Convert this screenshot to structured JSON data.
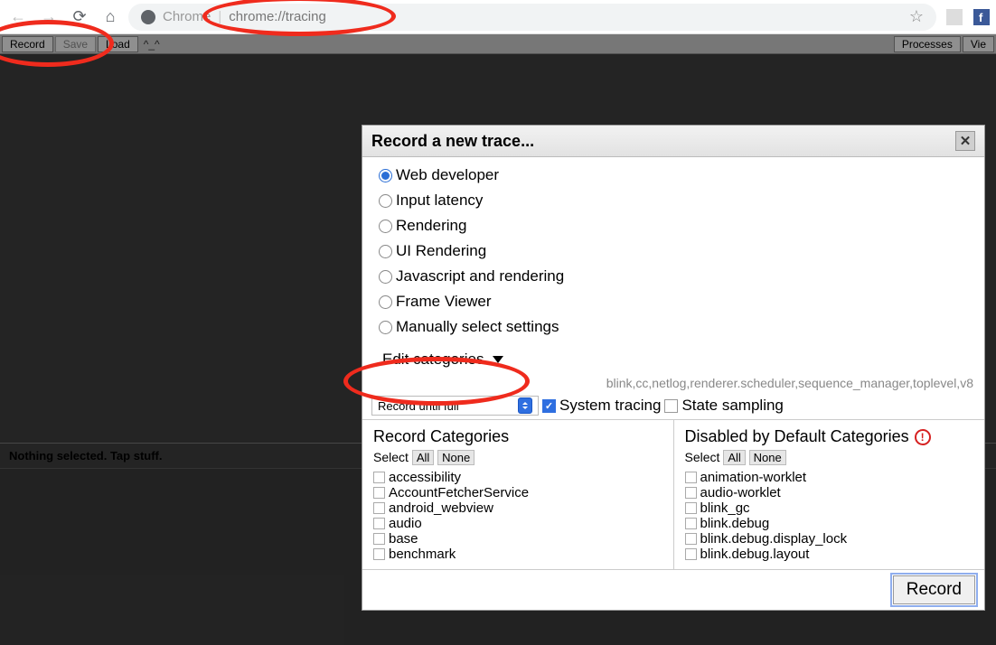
{
  "browser": {
    "prefix": "Chrome",
    "url": "chrome://tracing"
  },
  "toolbar": {
    "record": "Record",
    "save": "Save",
    "load": "Load",
    "emote": "^_^",
    "processes": "Processes",
    "view": "Vie"
  },
  "status": "Nothing selected. Tap stuff.",
  "dialog": {
    "title": "Record a new trace...",
    "radios": [
      "Web developer",
      "Input latency",
      "Rendering",
      "UI Rendering",
      "Javascript and rendering",
      "Frame Viewer",
      "Manually select settings"
    ],
    "selected_radio": 0,
    "edit_label": "Edit categories",
    "helper": "blink,cc,netlog,renderer.scheduler,sequence_manager,toplevel,v8",
    "mode_select": "Record until full",
    "opts": {
      "system_tracing": "System tracing",
      "state_sampling": "State sampling"
    },
    "left": {
      "heading": "Record Categories",
      "select_label": "Select",
      "all": "All",
      "none": "None",
      "items": [
        "accessibility",
        "AccountFetcherService",
        "android_webview",
        "audio",
        "base",
        "benchmark"
      ]
    },
    "right": {
      "heading": "Disabled by Default Categories",
      "select_label": "Select",
      "all": "All",
      "none": "None",
      "items": [
        "animation-worklet",
        "audio-worklet",
        "blink_gc",
        "blink.debug",
        "blink.debug.display_lock",
        "blink.debug.layout"
      ]
    },
    "record_btn": "Record"
  }
}
